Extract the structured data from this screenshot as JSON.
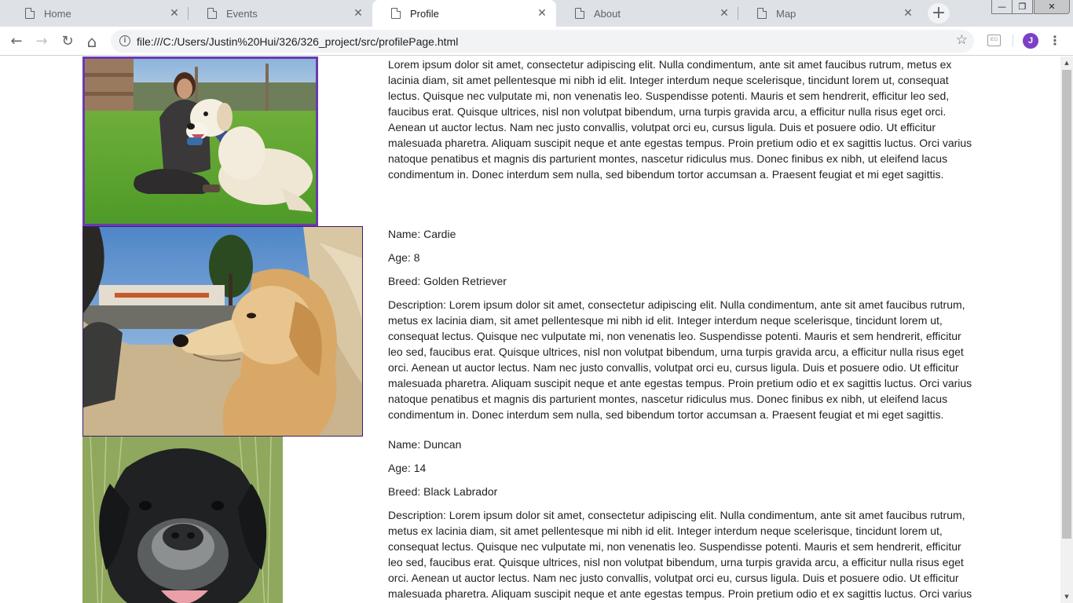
{
  "browser": {
    "tabs": [
      {
        "title": "Home",
        "active": false
      },
      {
        "title": "Events",
        "active": false
      },
      {
        "title": "Profile",
        "active": true
      },
      {
        "title": "About",
        "active": false
      },
      {
        "title": "Map",
        "active": false
      }
    ],
    "new_tab_label": "+",
    "tab_close_glyph": "✕",
    "window_controls": {
      "minimize": "—",
      "maximize": "❐",
      "close": "✕"
    },
    "nav": {
      "back": "←",
      "forward": "→",
      "reload": "↻",
      "home": "⌂"
    },
    "info_glyph": "i",
    "url": "file:///C:/Users/Justin%20Hui/326/326_project/src/profilePage.html",
    "bookmark_glyph": "☆",
    "extension_icon": "ext-icon",
    "extension_text": "IEG",
    "avatar_letter": "J",
    "menu_glyph": "⋮",
    "accent_color": "#6a3ab2"
  },
  "profile": {
    "owner_bio": "Lorem ipsum dolor sit amet, consectetur adipiscing elit. Nulla condimentum, ante sit amet faucibus rutrum, metus ex lacinia diam, sit amet pellentesque mi nibh id elit. Integer interdum neque scelerisque, tincidunt lorem ut, consequat lectus. Quisque nec vulputate mi, non venenatis leo. Suspendisse potenti. Mauris et sem hendrerit, efficitur leo sed, faucibus erat. Quisque ultrices, nisl non volutpat bibendum, urna turpis gravida arcu, a efficitur nulla risus eget orci. Aenean ut auctor lectus. Nam nec justo convallis, volutpat orci eu, cursus ligula. Duis et posuere odio. Ut efficitur malesuada pharetra. Aliquam suscipit neque et ante egestas tempus. Proin pretium odio et ex sagittis luctus. Orci varius natoque penatibus et magnis dis parturient montes, nascetur ridiculus mus. Donec finibus ex nibh, ut eleifend lacus condimentum in. Donec interdum sem nulla, sed bibendum tortor accumsan a. Praesent feugiat et mi eget sagittis.",
    "dogs": [
      {
        "name": "Name: Cardie",
        "age": "Age: 8",
        "breed": "Breed: Golden Retriever",
        "description": "Description: Lorem ipsum dolor sit amet, consectetur adipiscing elit. Nulla condimentum, ante sit amet faucibus rutrum, metus ex lacinia diam, sit amet pellentesque mi nibh id elit. Integer interdum neque scelerisque, tincidunt lorem ut, consequat lectus. Quisque nec vulputate mi, non venenatis leo. Suspendisse potenti. Mauris et sem hendrerit, efficitur leo sed, faucibus erat. Quisque ultrices, nisl non volutpat bibendum, urna turpis gravida arcu, a efficitur nulla risus eget orci. Aenean ut auctor lectus. Nam nec justo convallis, volutpat orci eu, cursus ligula. Duis et posuere odio. Ut efficitur malesuada pharetra. Aliquam suscipit neque et ante egestas tempus. Proin pretium odio et ex sagittis luctus. Orci varius natoque penatibus et magnis dis parturient montes, nascetur ridiculus mus. Donec finibus ex nibh, ut eleifend lacus condimentum in. Donec interdum sem nulla, sed bibendum tortor accumsan a. Praesent feugiat et mi eget sagittis."
      },
      {
        "name": "Name: Duncan",
        "age": "Age: 14",
        "breed": "Breed: Black Labrador",
        "description": "Description: Lorem ipsum dolor sit amet, consectetur adipiscing elit. Nulla condimentum, ante sit amet faucibus rutrum, metus ex lacinia diam, sit amet pellentesque mi nibh id elit. Integer interdum neque scelerisque, tincidunt lorem ut, consequat lectus. Quisque nec vulputate mi, non venenatis leo. Suspendisse potenti. Mauris et sem hendrerit, efficitur leo sed, faucibus erat. Quisque ultrices, nisl non volutpat bibendum, urna turpis gravida arcu, a efficitur nulla risus eget orci. Aenean ut auctor lectus. Nam nec justo convallis, volutpat orci eu, cursus ligula. Duis et posuere odio. Ut efficitur malesuada pharetra. Aliquam suscipit neque et ante egestas tempus. Proin pretium odio et ex sagittis luctus. Orci varius natoque penatibus et magnis dis parturient montes, nascetur ridiculus mus. Donec finibus ex nibh, ut eleifend lacus condimentum in. Donec interdum sem nulla, sed bibendum tortor accumsan a. Praesent feugiat et mi eget sagittis."
      }
    ]
  },
  "scrollbar": {
    "up_glyph": "▲",
    "down_glyph": "▼"
  }
}
